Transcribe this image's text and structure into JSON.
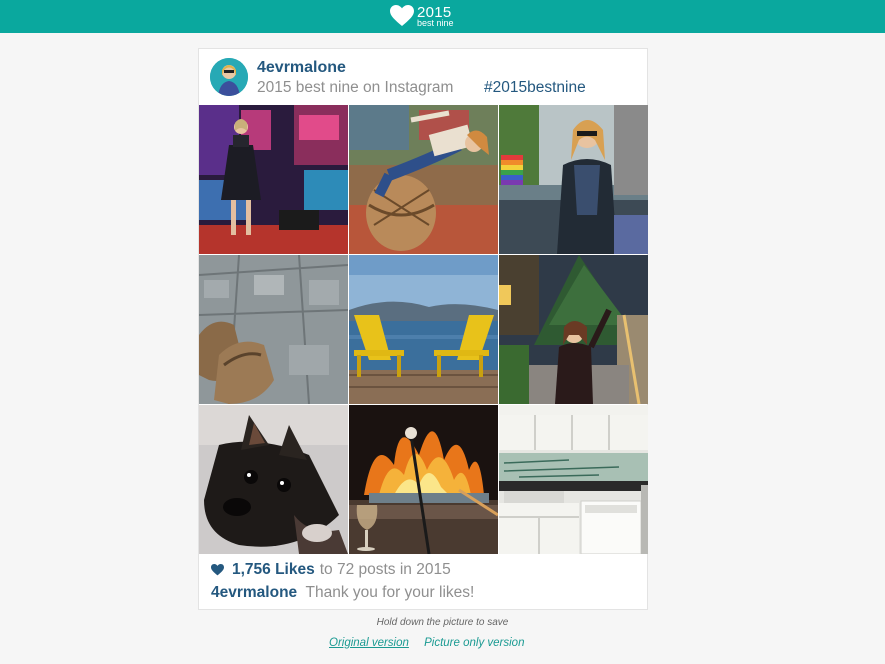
{
  "header": {
    "logo_year": "2015",
    "logo_sub": "best nine",
    "bg_color": "#0aa89e"
  },
  "card": {
    "username": "4evrmalone",
    "subtitle": "2015 best nine on Instagram",
    "hashtag": "#2015bestnine",
    "likes_count": "1,756 Likes",
    "likes_suffix": "to 72 posts in 2015",
    "thanks_user": "4evrmalone",
    "thanks_message": "Thank you for your likes!",
    "accent_color": "#24587f",
    "photos": [
      {
        "name": "photo-times-square"
      },
      {
        "name": "photo-drum-seat"
      },
      {
        "name": "photo-pride-parade"
      },
      {
        "name": "photo-boots-map"
      },
      {
        "name": "photo-lake-chairs"
      },
      {
        "name": "photo-christmas-tree"
      },
      {
        "name": "photo-french-bulldog"
      },
      {
        "name": "photo-fire-pit"
      },
      {
        "name": "photo-kitchen"
      }
    ]
  },
  "footer": {
    "hint": "Hold down the picture to save",
    "original_link": "Original version",
    "picture_only_link": "Picture only version"
  }
}
